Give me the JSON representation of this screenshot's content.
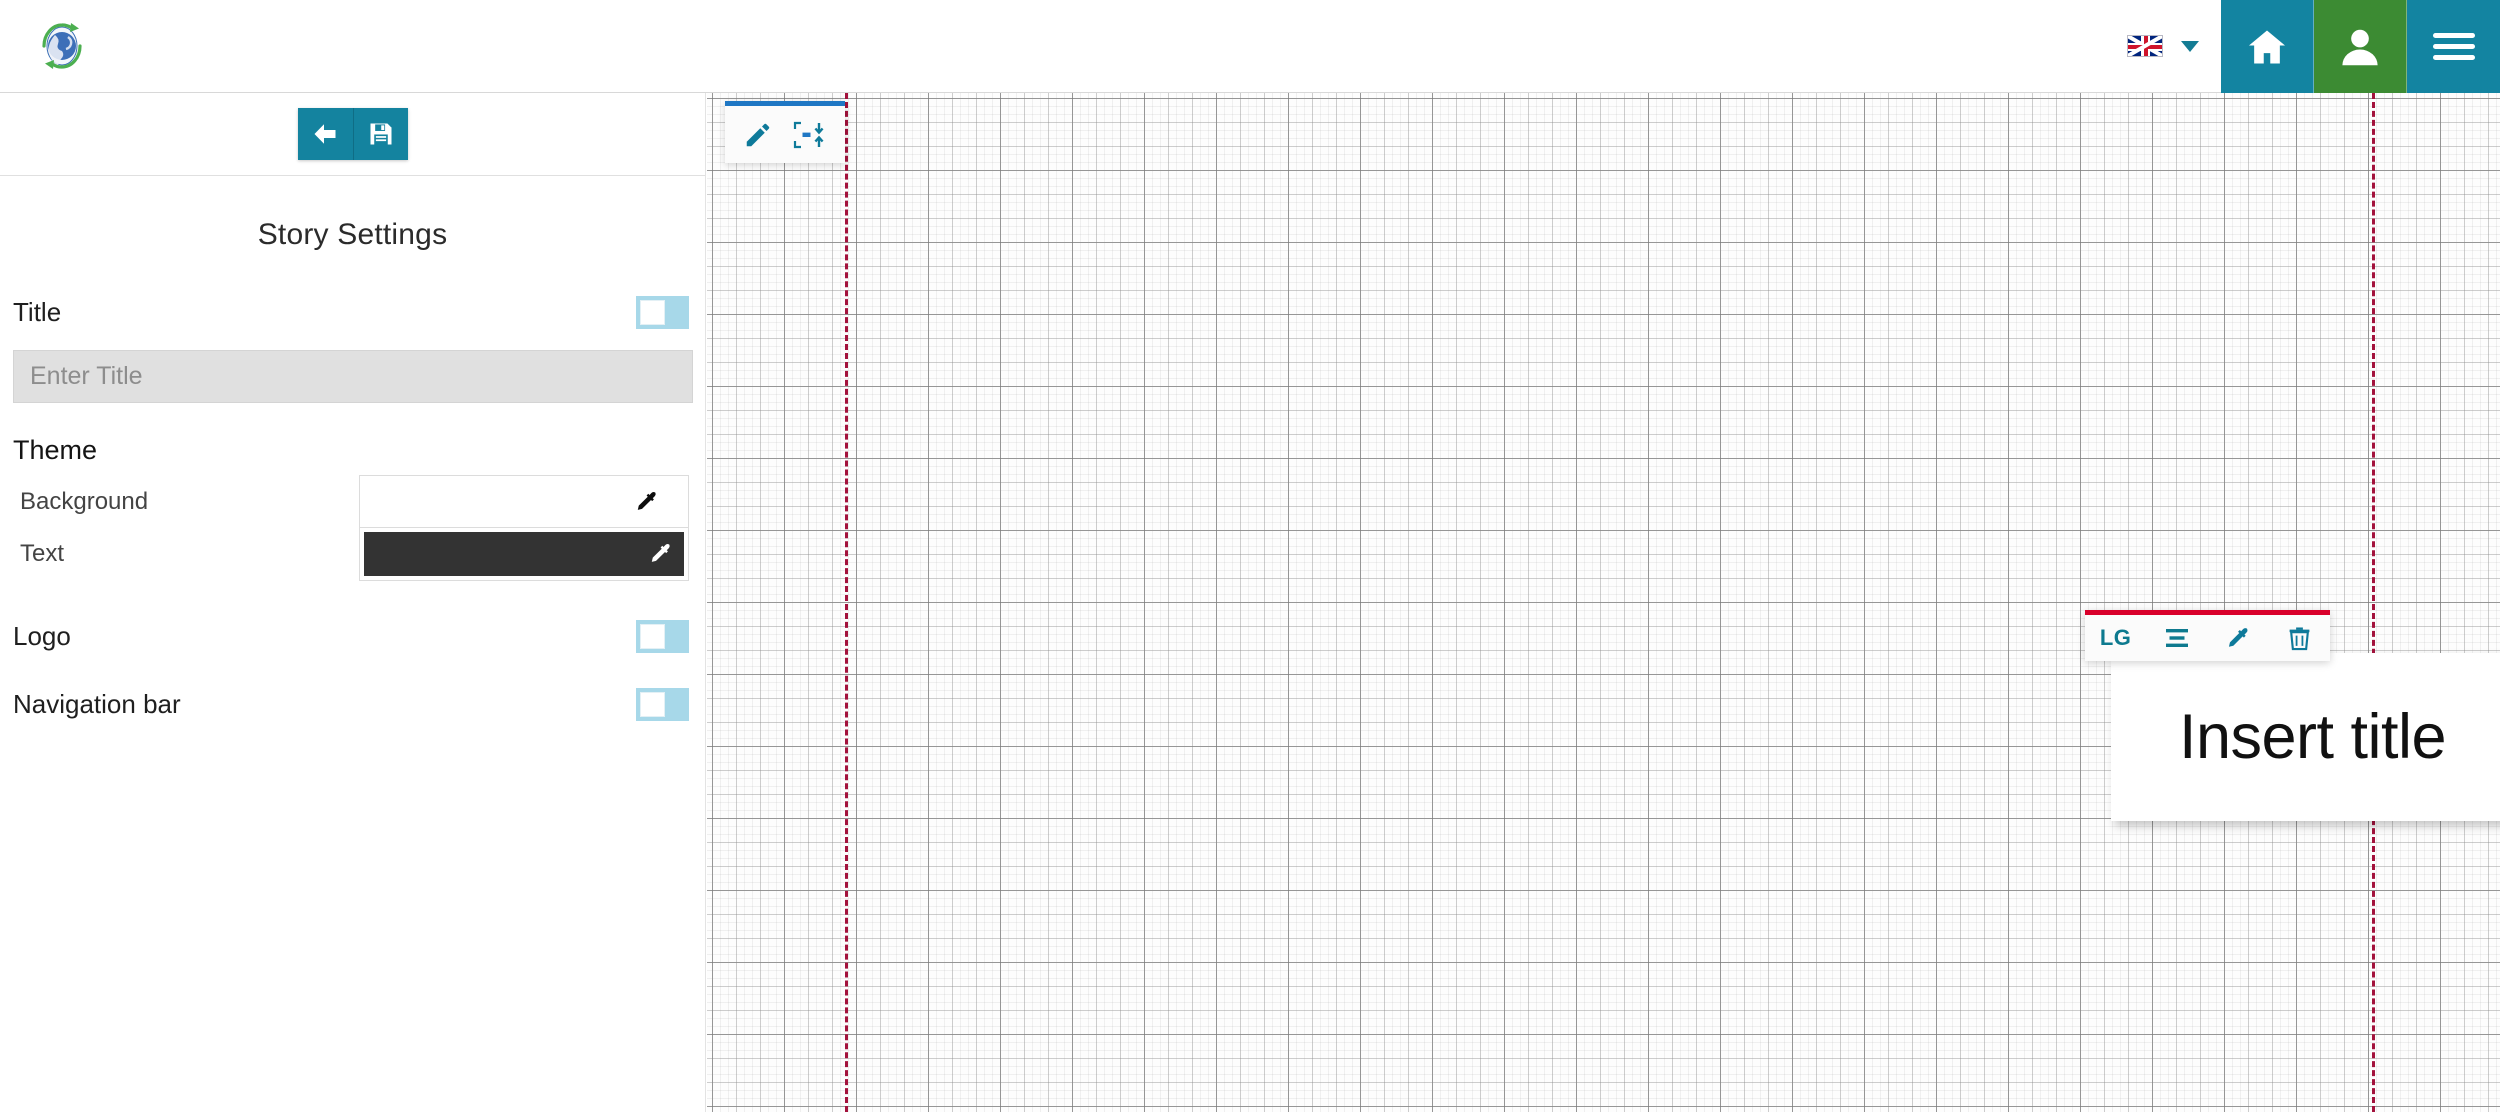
{
  "header": {
    "logo_icon": "globe-recycle-logo",
    "language": {
      "flag_icon": "uk-flag-icon",
      "dropdown_icon": "chevron-down-icon"
    },
    "buttons": [
      {
        "name": "home-button",
        "icon": "home-icon",
        "color": "#1384a1"
      },
      {
        "name": "account-button",
        "icon": "person-icon",
        "color": "#3c8b33"
      },
      {
        "name": "menu-button",
        "icon": "hamburger-menu-icon",
        "color": "#1384a1"
      }
    ]
  },
  "sidebar": {
    "toolbar": {
      "back_icon": "arrow-left-icon",
      "save_icon": "floppy-disk-save-icon",
      "button_color": "#14839f"
    },
    "panel_title": "Story Settings",
    "title_field": {
      "label": "Title",
      "placeholder": "Enter Title",
      "value": "",
      "toggle_on": false
    },
    "theme": {
      "heading": "Theme",
      "background": {
        "label": "Background",
        "color": "#ffffff",
        "picker_icon": "eyedropper-icon"
      },
      "text": {
        "label": "Text",
        "color": "#333333",
        "picker_icon": "eyedropper-icon"
      }
    },
    "logo_field": {
      "label": "Logo",
      "toggle_on": false
    },
    "navbar_field": {
      "label": "Navigation bar",
      "toggle_on": false
    },
    "toggle_color": "#a7d8e9"
  },
  "canvas": {
    "toolbar": {
      "accent_color": "#1f77c4",
      "edit_icon": "pencil-edit-icon",
      "fit_icon": "fit-to-content-icon"
    },
    "guides": {
      "color": "#a3123c",
      "style": "dashed"
    },
    "element_toolbar": {
      "accent_color": "#d9002b",
      "size_label": "LG",
      "align_icon": "align-center-icon",
      "color_icon": "eyedropper-icon",
      "delete_icon": "trash-delete-icon"
    },
    "title_card": {
      "text": "Insert title"
    }
  }
}
